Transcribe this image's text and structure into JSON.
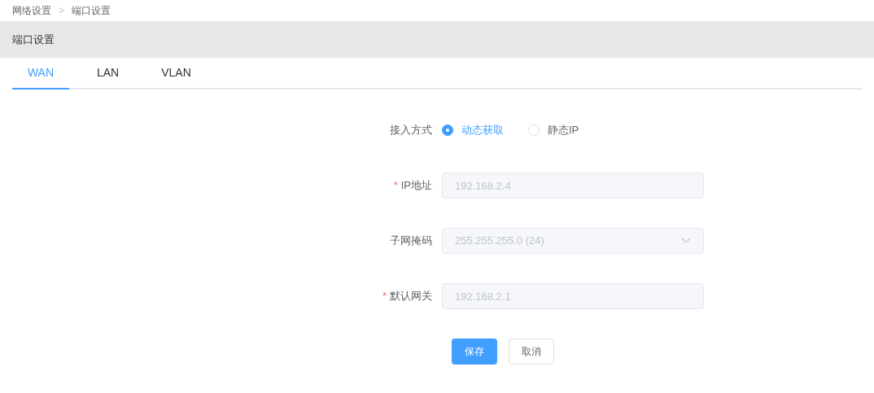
{
  "breadcrumb": [
    {
      "label": "网络设置"
    },
    {
      "label": "端口设置"
    }
  ],
  "breadcrumb_separator": ">",
  "header": {
    "title": "端口设置"
  },
  "tabs": [
    {
      "label": "WAN",
      "selected": true
    },
    {
      "label": "LAN",
      "selected": false
    },
    {
      "label": "VLAN",
      "selected": false
    }
  ],
  "form": {
    "fields": [
      {
        "kind": "radio",
        "label": "接入方式",
        "options": [
          {
            "label": "动态获取",
            "selected": true
          },
          {
            "label": "静态IP",
            "selected": false
          }
        ]
      },
      {
        "kind": "input",
        "label": "IP地址",
        "required_mark": "*",
        "value": "192.168.2.4",
        "disabled": true
      },
      {
        "kind": "select",
        "label": "子网掩码",
        "value": "255.255.255.0 (24)",
        "disabled": true
      },
      {
        "kind": "input",
        "label": "默认网关",
        "required_mark": "*",
        "value": "192.168.2.1",
        "disabled": true
      }
    ],
    "buttons": [
      {
        "label": "保存",
        "kind": "primary"
      },
      {
        "label": "取消",
        "kind": "default"
      }
    ]
  }
}
